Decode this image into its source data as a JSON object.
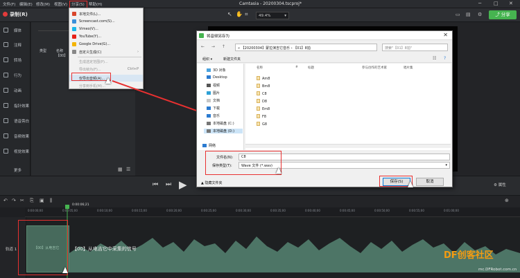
{
  "menubar": {
    "items": [
      "文件(F)",
      "编辑(E)",
      "修改(M)",
      "视图(V)",
      "分享(S)",
      "帮助(H)"
    ],
    "title": "Camtasia - 20200304.tscproj*"
  },
  "toolbar": {
    "record_label": "录制(R)",
    "zoom_value": "49.4%",
    "share_label": "分享"
  },
  "sidebar": {
    "items": [
      {
        "label": "媒体",
        "icon": "media-icon"
      },
      {
        "label": "注释",
        "icon": "annotation-icon"
      },
      {
        "label": "转场",
        "icon": "transition-icon"
      },
      {
        "label": "行为",
        "icon": "behavior-icon"
      },
      {
        "label": "动画",
        "icon": "animation-icon"
      },
      {
        "label": "指针效果",
        "icon": "cursor-effect-icon"
      },
      {
        "label": "语音旁白",
        "icon": "voice-icon"
      },
      {
        "label": "音频效果",
        "icon": "audio-effect-icon"
      },
      {
        "label": "视觉效果",
        "icon": "visual-effect-icon"
      }
    ],
    "more_label": "更多"
  },
  "library": {
    "col_type": "类型",
    "col_name": "名称",
    "row_name": "【00】"
  },
  "share_menu": {
    "items": [
      {
        "label": "本地文件(L)...",
        "color": "#d9462b"
      },
      {
        "label": "Screencast.com(S)...",
        "color": "#3a8fd9"
      },
      {
        "label": "Vimeo(V)...",
        "color": "#1ab7ea"
      },
      {
        "label": "YouTube(Y)...",
        "color": "#e62117"
      },
      {
        "label": "Google Drive(G)...",
        "color": "#f4b400"
      },
      {
        "label": "自定义生成(C)",
        "color": "#888888"
      },
      {
        "label": "生成选定范围(P)...",
        "color": ""
      },
      {
        "label": "导出帧为(F)...",
        "color": ""
      },
      {
        "label": "仅导出音频(A)...",
        "color": ""
      },
      {
        "label": "分享到手机(M)...",
        "color": ""
      }
    ],
    "shortcut": "Ctrl+P"
  },
  "dialog": {
    "title": "将音频另存为",
    "address": "« 【20200304】蒙拉演吉它音乐 › 【01】8拍",
    "search_placeholder": "搜索\"【01】8拍\"",
    "organize": "组织 ▾",
    "new_folder": "新建文件夹",
    "tree": [
      {
        "label": "3D 对象",
        "color": "#4aa3df"
      },
      {
        "label": "Desktop",
        "color": "#2c7bd0"
      },
      {
        "label": "视频",
        "color": "#555555"
      },
      {
        "label": "图片",
        "color": "#2fa1d6"
      },
      {
        "label": "文档",
        "color": "#c7c7c7"
      },
      {
        "label": "下载",
        "color": "#2c7bd0"
      },
      {
        "label": "音乐",
        "color": "#2c7bd0"
      },
      {
        "label": "本地磁盘 (C:)",
        "color": "#777777"
      },
      {
        "label": "本地磁盘 (D:)",
        "color": "#777777"
      },
      {
        "label": "网络",
        "color": "#2c7bd0"
      }
    ],
    "columns": [
      "名称",
      "#",
      "标题",
      "参与创作的艺术家",
      "唱片集"
    ],
    "files": [
      "Am8",
      "Bm8",
      "C8",
      "D8",
      "Em8",
      "F8",
      "G8"
    ],
    "filename_label": "文件名(N):",
    "filename_value": "C8",
    "filetype_label": "保存类型(T):",
    "filetype_value": "Wave 文件 (*.wav)",
    "hide_folders": "隐藏文件夹",
    "save": "保存(S)",
    "cancel": "取消"
  },
  "transport": {
    "properties": "属性"
  },
  "timeline": {
    "ruler_ticks": [
      "0:00:00;00",
      "0:00:05;00",
      "0:00:10;00",
      "0:00:15;00",
      "0:00:20;00",
      "0:00:25;00",
      "0:00:30;00",
      "0:00:35;00",
      "0:00:40;00",
      "0:00:45;00",
      "0:00:50;00",
      "0:00:55;00",
      "0:01:00;00"
    ],
    "playhead_time": "0:00:06;21",
    "track_label": "轨道 1",
    "clip_name": "【00】从电吉它",
    "clip_label": "【00】从电吉它中采集的信号"
  },
  "watermark": {
    "brand": "DF创客社区",
    "url": "mc.DFRobot.com.cn"
  }
}
